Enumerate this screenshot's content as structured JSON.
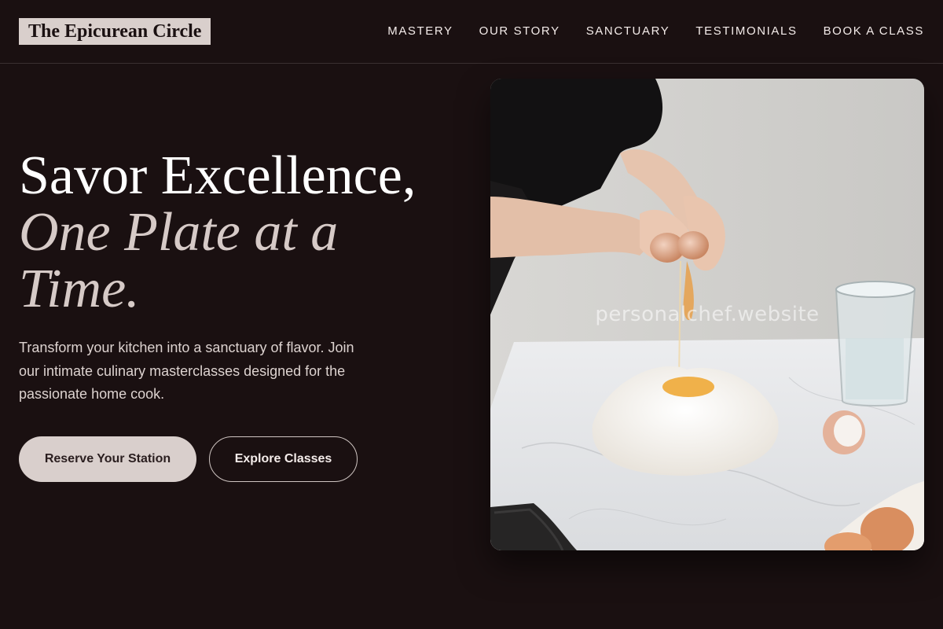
{
  "brand": {
    "name": "The Epicurean Circle"
  },
  "nav": {
    "items": [
      {
        "label": "MASTERY"
      },
      {
        "label": "OUR STORY"
      },
      {
        "label": "SANCTUARY"
      },
      {
        "label": "TESTIMONIALS"
      },
      {
        "label": "BOOK A CLASS"
      }
    ]
  },
  "hero": {
    "headline_line1": "Savor Excellence,",
    "headline_line2": "One Plate at a Time.",
    "subtext": "Transform your kitchen into a sanctuary of flavor. Join our intimate culinary masterclasses designed for the passionate home cook.",
    "primary_cta": "Reserve Your Station",
    "secondary_cta": "Explore Classes",
    "image_watermark": "personalchef.website",
    "image_icon": "photo-cracking-egg-into-flour-icon"
  },
  "colors": {
    "background": "#1a1011",
    "accent": "#d9cfcc",
    "text": "#ece4e1"
  }
}
